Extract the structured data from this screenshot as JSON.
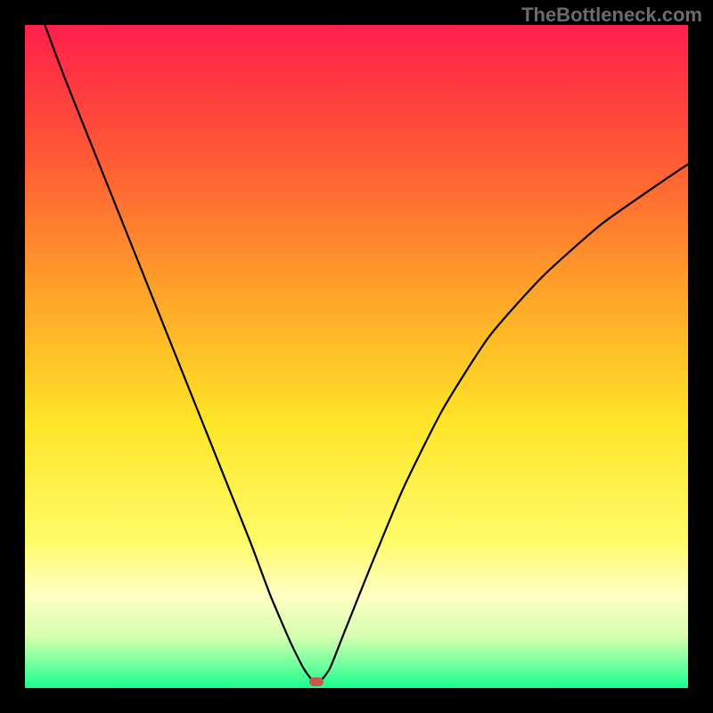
{
  "watermark": "TheBottleneck.com",
  "chart_data": {
    "type": "line",
    "title": "",
    "xlabel": "",
    "ylabel": "",
    "xlim": [
      0,
      100
    ],
    "ylim": [
      0,
      100
    ],
    "grid": false,
    "legend": false,
    "background_gradient": {
      "stops": [
        {
          "offset": 0.0,
          "color": "#ff1f4b"
        },
        {
          "offset": 0.2,
          "color": "#ff5a35"
        },
        {
          "offset": 0.4,
          "color": "#ffa229"
        },
        {
          "offset": 0.6,
          "color": "#ffe528"
        },
        {
          "offset": 0.78,
          "color": "#fffc6a"
        },
        {
          "offset": 0.86,
          "color": "#ffffc4"
        },
        {
          "offset": 0.92,
          "color": "#d9ffb0"
        },
        {
          "offset": 0.96,
          "color": "#7dffa0"
        },
        {
          "offset": 1.0,
          "color": "#17ff90"
        }
      ]
    },
    "series": [
      {
        "name": "curve",
        "color": "#000000",
        "stroke_width": 2.2,
        "x": [
          3,
          6,
          10,
          14,
          18,
          22,
          26,
          30,
          34,
          37,
          40,
          42,
          43.5,
          44.5,
          46,
          48,
          52,
          57,
          63,
          70,
          78,
          87,
          97,
          100
        ],
        "y": [
          100,
          92,
          82,
          72,
          62,
          52,
          42,
          32,
          22,
          14,
          7,
          3,
          1,
          1,
          3,
          8,
          18,
          30,
          42,
          53,
          62,
          70,
          77,
          79
        ]
      }
    ],
    "marker": {
      "x": 44,
      "y": 1,
      "color": "#c9584c"
    }
  }
}
